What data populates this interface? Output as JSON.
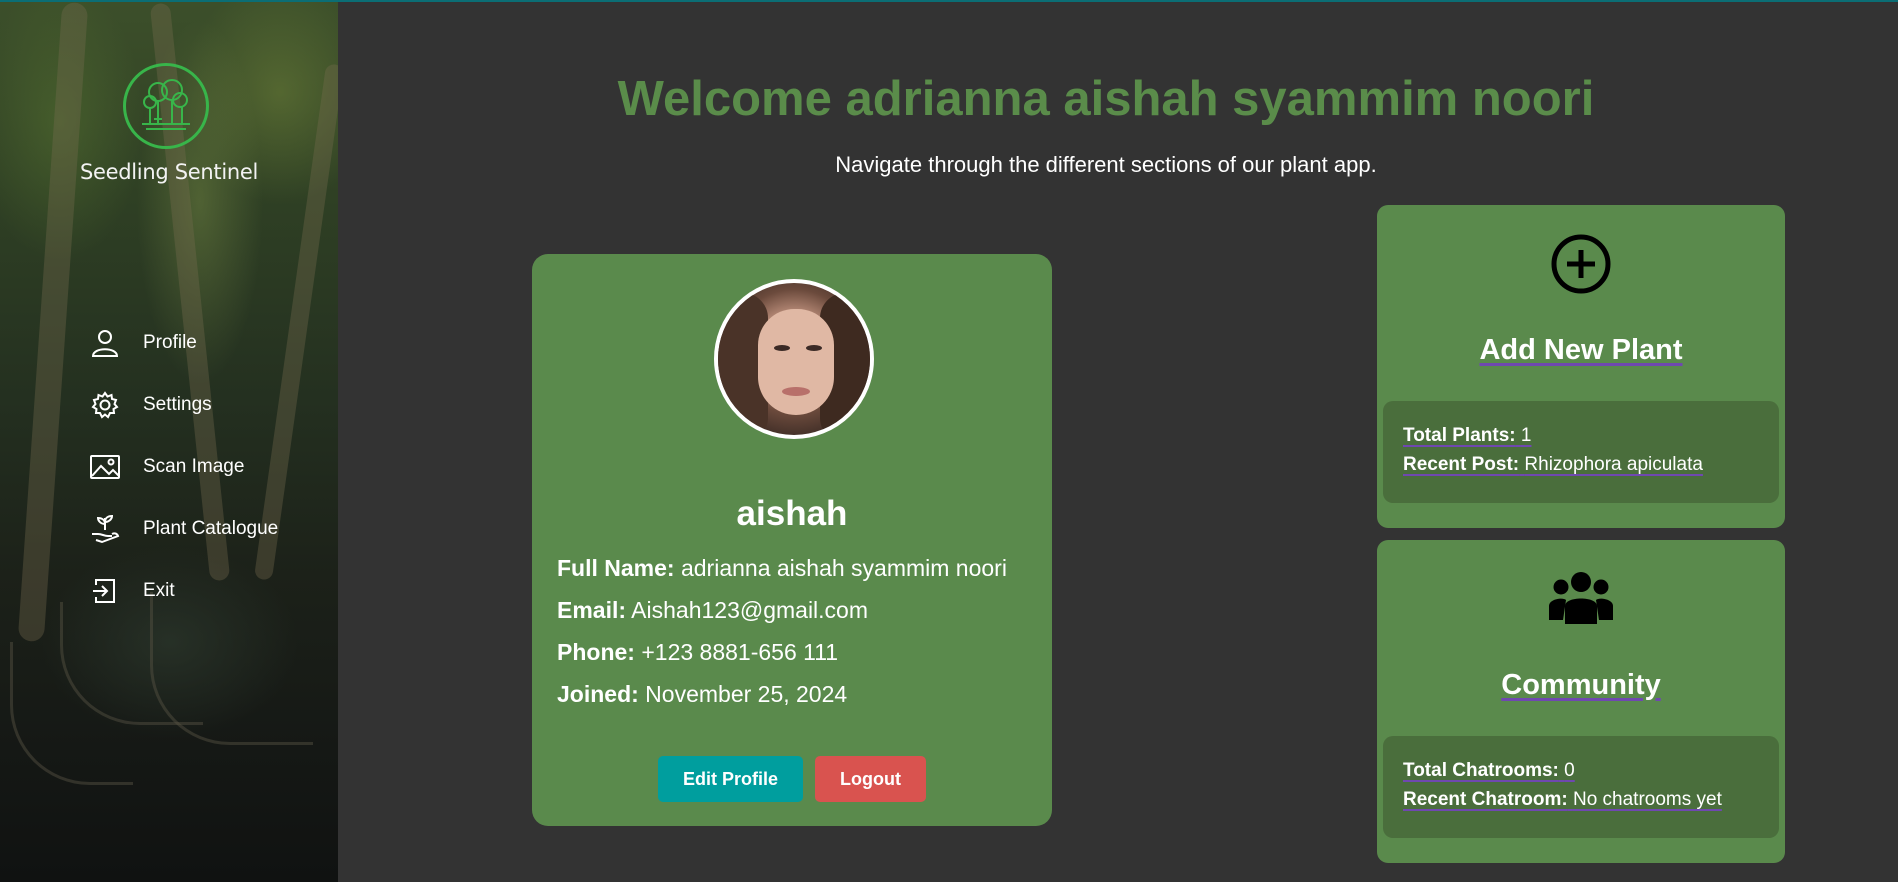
{
  "app": {
    "brand_name": "Seedling Sentinel",
    "accent_color": "#5a8c4a",
    "card_color": "#5a8a4c",
    "logo_color": "#38b54a"
  },
  "sidebar": {
    "items": [
      {
        "label": "Profile",
        "icon": "user-icon"
      },
      {
        "label": "Settings",
        "icon": "gear-icon"
      },
      {
        "label": "Scan Image",
        "icon": "image-icon"
      },
      {
        "label": "Plant Catalogue",
        "icon": "plant-hand-icon"
      },
      {
        "label": "Exit",
        "icon": "exit-icon"
      }
    ]
  },
  "header": {
    "welcome": "Welcome adrianna aishah syammim noori",
    "subtitle": "Navigate through the different sections of our plant app."
  },
  "profile": {
    "username": "aishah",
    "full_name_label": "Full Name:",
    "full_name": "adrianna aishah syammim noori",
    "email_label": "Email:",
    "email": "Aishah123@gmail.com",
    "phone_label": "Phone:",
    "phone": "+123 8881-656 111",
    "joined_label": "Joined:",
    "joined": "November 25, 2024",
    "edit_button": "Edit Profile",
    "logout_button": "Logout",
    "edit_color": "#009e9e",
    "logout_color": "#d9534f"
  },
  "add_plant_card": {
    "title": "Add New Plant",
    "icon": "plus-circle-icon",
    "total_label": "Total Plants:",
    "total_value": "1",
    "recent_label": "Recent Post:",
    "recent_value": "Rhizophora apiculata"
  },
  "community_card": {
    "title": "Community",
    "icon": "users-icon",
    "total_label": "Total Chatrooms:",
    "total_value": "0",
    "recent_label": "Recent Chatroom:",
    "recent_value": "No chatrooms yet"
  }
}
